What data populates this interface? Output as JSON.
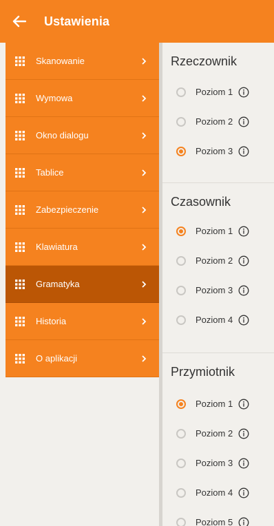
{
  "header": {
    "title": "Ustawienia"
  },
  "sidebar": {
    "items": [
      {
        "label": "Skanowanie"
      },
      {
        "label": "Wymowa"
      },
      {
        "label": "Okno dialogu"
      },
      {
        "label": "Tablice"
      },
      {
        "label": "Zabezpieczenie"
      },
      {
        "label": "Klawiatura"
      },
      {
        "label": "Gramatyka",
        "active": true
      },
      {
        "label": "Historia"
      },
      {
        "label": "O aplikacji"
      }
    ]
  },
  "colors": {
    "accent": "#f5821f",
    "active": "#bb5605"
  },
  "main": {
    "sections": [
      {
        "title": "Rzeczownik",
        "options": [
          {
            "label": "Poziom 1",
            "selected": false
          },
          {
            "label": "Poziom 2",
            "selected": false
          },
          {
            "label": "Poziom 3",
            "selected": true
          }
        ]
      },
      {
        "title": "Czasownik",
        "options": [
          {
            "label": "Poziom 1",
            "selected": true
          },
          {
            "label": "Poziom 2",
            "selected": false
          },
          {
            "label": "Poziom 3",
            "selected": false
          },
          {
            "label": "Poziom 4",
            "selected": false
          }
        ]
      },
      {
        "title": "Przymiotnik",
        "options": [
          {
            "label": "Poziom 1",
            "selected": true
          },
          {
            "label": "Poziom 2",
            "selected": false
          },
          {
            "label": "Poziom 3",
            "selected": false
          },
          {
            "label": "Poziom 4",
            "selected": false
          },
          {
            "label": "Poziom 5",
            "selected": false
          }
        ]
      }
    ]
  }
}
